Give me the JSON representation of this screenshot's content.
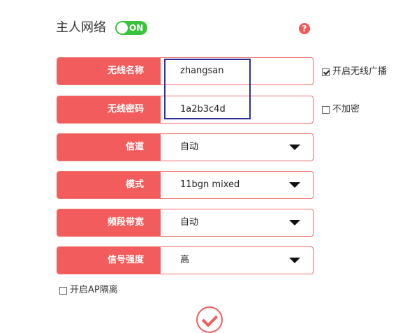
{
  "header": {
    "title": "主人网络",
    "toggle_label": "ON",
    "help_glyph": "?"
  },
  "fields": {
    "ssid": {
      "label": "无线名称",
      "value": "zhangsan"
    },
    "password": {
      "label": "无线密码",
      "value": "1a2b3c4d"
    },
    "channel": {
      "label": "信道",
      "value": "自动"
    },
    "mode": {
      "label": "模式",
      "value": "11bgn mixed"
    },
    "bandwidth": {
      "label": "频段带宽",
      "value": "自动"
    },
    "signal": {
      "label": "信号强度",
      "value": "高"
    }
  },
  "options": {
    "broadcast": {
      "label": "开启无线广播",
      "checked": true
    },
    "no_encrypt": {
      "label": "不加密",
      "checked": false
    },
    "ap_isolation": {
      "label": "开启AP隔离",
      "checked": false
    }
  },
  "colors": {
    "accent": "#f25c5c",
    "toggle_on": "#3bc43b",
    "highlight_box": "#2b2e9c"
  },
  "icons": {
    "help": "question-circle-icon",
    "dropdown": "caret-down-icon",
    "save": "check-circle-icon"
  }
}
